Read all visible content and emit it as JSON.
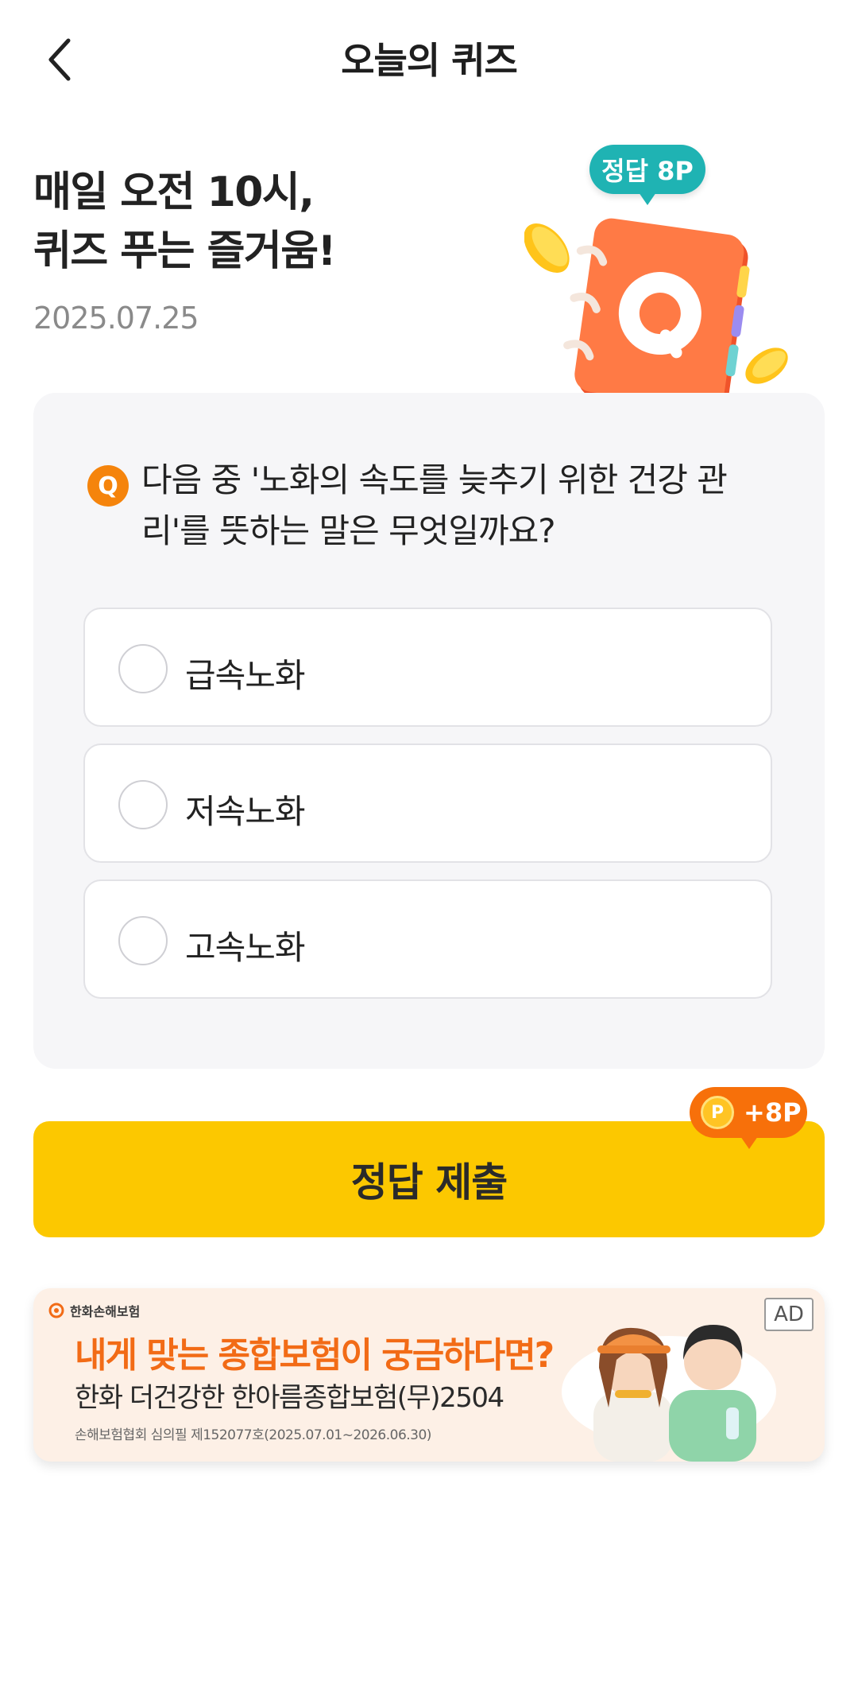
{
  "header": {
    "title": "오늘의 퀴즈"
  },
  "hero": {
    "title_line1": "매일 오전 10시,",
    "title_line2": "퀴즈 푸는 즐거움!",
    "date": "2025.07.25",
    "reward_badge": "정답 8P"
  },
  "quiz": {
    "q_marker": "Q",
    "question": "다음 중 '노화의 속도를 늦추기 위한 건강 관리'를 뜻하는 말은 무엇일까요?",
    "options": [
      {
        "label": "급속노화",
        "selected": false
      },
      {
        "label": "저속노화",
        "selected": false
      },
      {
        "label": "고속노화",
        "selected": false
      }
    ]
  },
  "submit": {
    "label": "정답 제출",
    "point_badge": "+8P",
    "coin_symbol": "P"
  },
  "ad": {
    "brand": "한화손해보험",
    "headline": "내게 맞는 종합보험이 궁금하다면?",
    "subline": "한화 더건강한 한아름종합보험(무)2504",
    "fine_print": "손해보험협회 심의필 제152077호(2025.07.01~2026.06.30)",
    "tag": "AD"
  },
  "colors": {
    "accent_yellow": "#fcc800",
    "badge_teal": "#1fb3b3",
    "point_orange": "#f7700a",
    "q_orange": "#f5840c",
    "ad_orange": "#f26b16"
  },
  "icons": [
    "back-chevron-icon",
    "quiz-notebook-icon",
    "coin-icon",
    "q-marker-icon"
  ]
}
